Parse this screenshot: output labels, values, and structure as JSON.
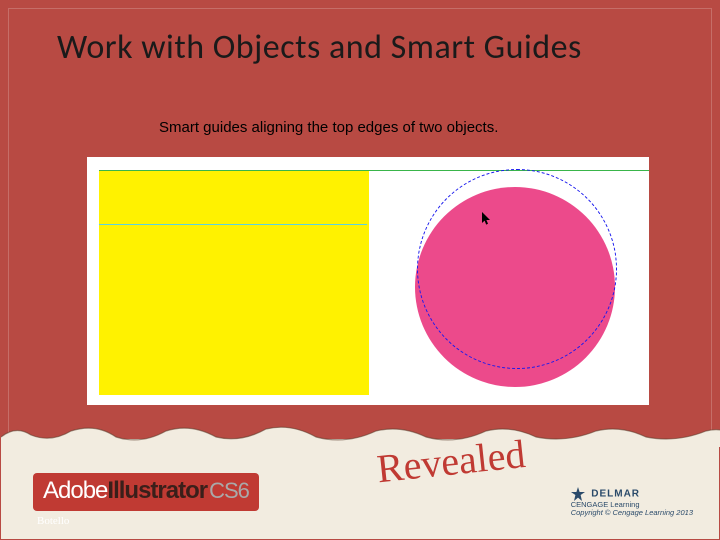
{
  "title": "Work with Objects and Smart Guides",
  "caption": "Smart guides aligning the top edges of two objects.",
  "figure": {
    "yellow_rect": {
      "name": "yellow-rectangle"
    },
    "pink_circle": {
      "name": "pink-circle"
    },
    "drag_outline": {
      "name": "dragging-circle-outline"
    },
    "guide_top": {
      "name": "smart-guide-top-align"
    },
    "guide_mid": {
      "name": "smart-guide-horizontal"
    },
    "cursor": {
      "name": "arrow-cursor"
    }
  },
  "footer": {
    "adobe": "Adobe",
    "product": "Illustrator",
    "version": "CS6",
    "revealed": "Revealed",
    "author": "Botello",
    "publisher_brand": "DELMAR",
    "publisher_sub": "CENGAGE Learning",
    "copyright": "Copyright © Cengage Learning 2013"
  },
  "colors": {
    "slide_bg": "#b84a43",
    "yellow": "#fff200",
    "pink": "#ec4a8b",
    "guide_green": "#39b54a",
    "guide_cyan": "#5ad1e6",
    "drag_blue": "#1a1aee",
    "footer_paper": "#f2ece0",
    "revealed_red": "#c03a33"
  }
}
